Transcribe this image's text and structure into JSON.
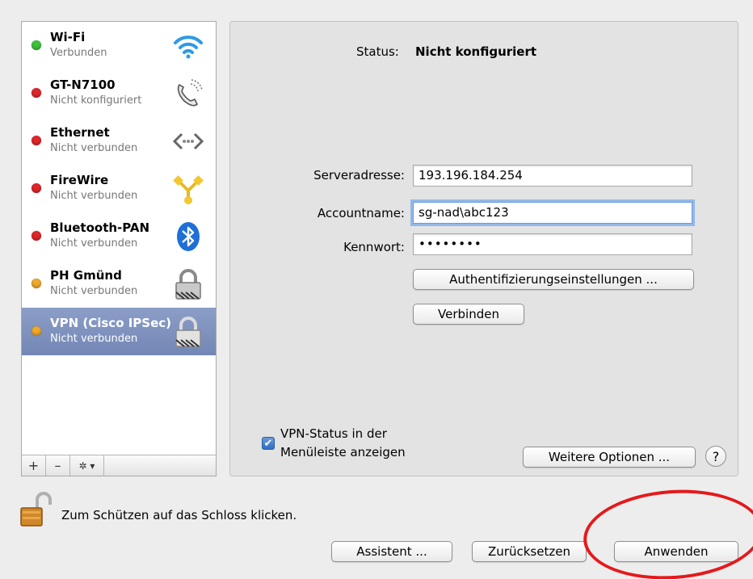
{
  "services": [
    {
      "name": "Wi-Fi",
      "status": "Verbunden",
      "dot_color": "#3ec23a",
      "icon": "wifi-icon",
      "selected": false
    },
    {
      "name": "GT-N7100",
      "status": "Nicht konfiguriert",
      "dot_color": "#e0262a",
      "icon": "phone-icon",
      "selected": false
    },
    {
      "name": "Ethernet",
      "status": "Nicht verbunden",
      "dot_color": "#e0262a",
      "icon": "ethernet-icon",
      "selected": false
    },
    {
      "name": "FireWire",
      "status": "Nicht verbunden",
      "dot_color": "#e0262a",
      "icon": "firewire-icon",
      "selected": false
    },
    {
      "name": "Bluetooth-PAN",
      "status": "Nicht verbunden",
      "dot_color": "#e0262a",
      "icon": "bluetooth-icon",
      "selected": false
    },
    {
      "name": "PH Gmünd",
      "status": "Nicht verbunden",
      "dot_color": "#f0a92a",
      "icon": "lock-icon",
      "selected": false
    },
    {
      "name": "VPN (Cisco IPSec)",
      "status": "Nicht verbunden",
      "dot_color": "#f0a92a",
      "icon": "lock-icon",
      "selected": true
    }
  ],
  "sidebar_toolbar": {
    "add": "+",
    "remove": "–",
    "action": "✲ ▾"
  },
  "status": {
    "label": "Status:",
    "value": "Nicht konfiguriert"
  },
  "form": {
    "server_label": "Serveradresse:",
    "server_value": "193.196.184.254",
    "account_label": "Accountname:",
    "account_value": "sg-nad\\abc123",
    "password_label": "Kennwort:",
    "password_value": "••••••••"
  },
  "buttons": {
    "auth": "Authentifizierungseinstellungen ...",
    "connect": "Verbinden",
    "more_options": "Weitere Optionen ...",
    "help": "?",
    "assistant": "Assistent ...",
    "reset": "Zurücksetzen",
    "apply": "Anwenden"
  },
  "vpn_status_checkbox": {
    "line1": "VPN-Status in der",
    "line2": "Menüleiste anzeigen",
    "checked": true
  },
  "lock_text": "Zum Schützen auf das Schloss klicken.",
  "colors": {
    "selection": "#7b8fbf",
    "annotation": "#e5191b",
    "focus": "#92b8ea"
  }
}
